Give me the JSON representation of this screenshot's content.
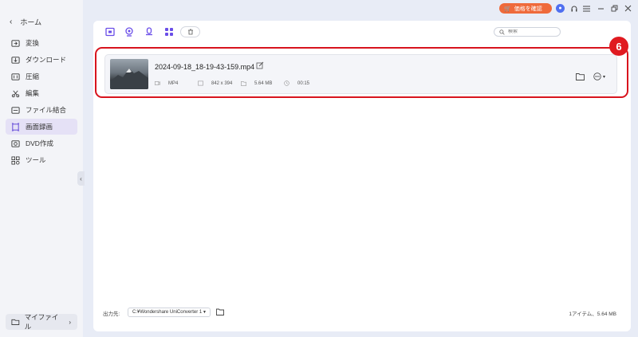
{
  "sidebar": {
    "home_label": "ホーム",
    "items": [
      {
        "label": "変換",
        "icon": "convert-icon"
      },
      {
        "label": "ダウンロード",
        "icon": "download-icon"
      },
      {
        "label": "圧縮",
        "icon": "compress-icon"
      },
      {
        "label": "編集",
        "icon": "scissors-icon"
      },
      {
        "label": "ファイル結合",
        "icon": "merge-icon"
      },
      {
        "label": "画面録画",
        "icon": "screen-record-icon",
        "active": true
      },
      {
        "label": "DVD作成",
        "icon": "dvd-icon"
      },
      {
        "label": "ツール",
        "icon": "tools-icon"
      }
    ],
    "my_files_label": "マイファイル"
  },
  "titlebar": {
    "price_label": "価格を確認"
  },
  "toolbar": {
    "search_placeholder": "検索"
  },
  "file": {
    "name": "2024-09-18_18-19-43-159.mp4",
    "format": "MP4",
    "resolution": "842 x 394",
    "size": "5.64 MB",
    "duration": "00:15"
  },
  "annotation": {
    "badge": "6"
  },
  "footer": {
    "output_label": "出力先:",
    "output_path": "C:¥Wondershare UniConverter 1",
    "summary": "1アイテム、5.64 MB"
  },
  "colors": {
    "accent": "#6a4ee8",
    "price_button": "#ef6a3b",
    "highlight": "#d8141e"
  }
}
